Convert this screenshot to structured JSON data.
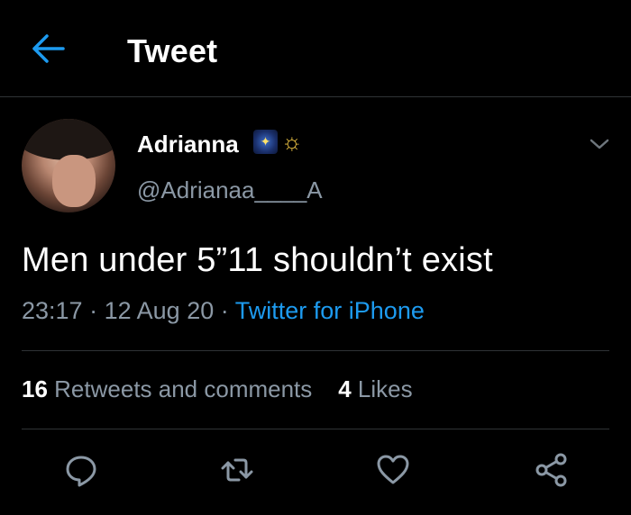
{
  "header": {
    "title": "Tweet",
    "back_icon": "arrow-left-icon"
  },
  "colors": {
    "background": "#000000",
    "accent": "#1d9bf0",
    "secondary_text": "#8b98a5",
    "divider": "#2f3336"
  },
  "tweet": {
    "display_name": "Adrianna",
    "name_emojis": [
      "night-sky-emoji",
      "halo-emoji"
    ],
    "handle": "@Adrianaa____A",
    "text": "Men under 5”11 shouldn’t exist",
    "time": "23:17",
    "separator": "·",
    "date": "12 Aug 20",
    "source": "Twitter for iPhone"
  },
  "stats": {
    "retweets_count": "16",
    "retweets_label": "Retweets and comments",
    "likes_count": "4",
    "likes_label": "Likes"
  },
  "actions": [
    "reply-icon",
    "retweet-icon",
    "like-icon",
    "share-icon"
  ]
}
